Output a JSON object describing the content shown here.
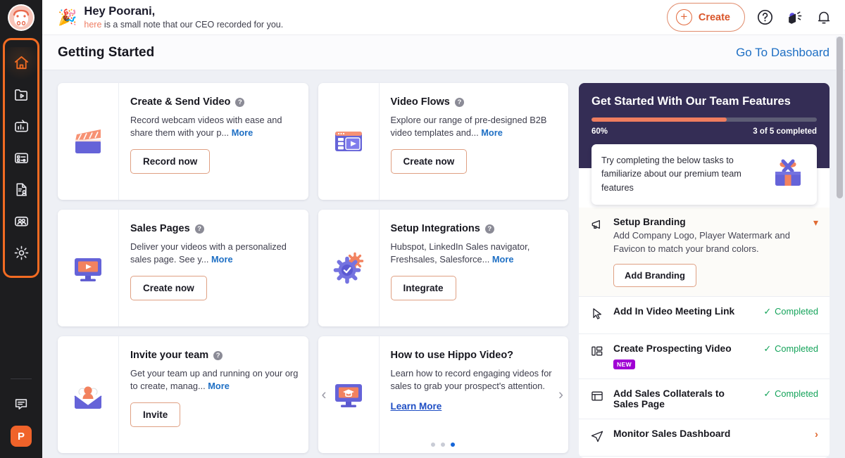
{
  "sidebar": {
    "logo_name": "hippo-logo",
    "items": [
      {
        "id": "home",
        "label": "Home",
        "icon": "home-icon",
        "active": true,
        "has_dots": true
      },
      {
        "id": "library",
        "label": "Video Library",
        "icon": "folder-video-icon",
        "active": false,
        "has_dots": false
      },
      {
        "id": "analytics",
        "label": "Analytics",
        "icon": "analytics-icon",
        "active": false,
        "has_dots": true
      },
      {
        "id": "flows",
        "label": "Flows",
        "icon": "flows-icon",
        "active": false,
        "has_dots": true
      },
      {
        "id": "prospects",
        "label": "Prospects",
        "icon": "document-person-icon",
        "active": false,
        "has_dots": false
      },
      {
        "id": "team",
        "label": "Team",
        "icon": "team-icon",
        "active": false,
        "has_dots": false
      },
      {
        "id": "settings",
        "label": "Settings",
        "icon": "gear-icon",
        "active": false,
        "has_dots": false
      }
    ],
    "chat_icon": "chat-bubble-icon",
    "avatar_initial": "P"
  },
  "topbar": {
    "party_icon": "party-popper-icon",
    "greeting": "Hey Poorani,",
    "note_link": "here",
    "note_rest": " is a small note that our CEO recorded for you.",
    "create_label": "Create",
    "help_icon": "help-circle-icon",
    "announce_icon": "megaphone-icon",
    "bell_icon": "bell-icon"
  },
  "pagehead": {
    "title": "Getting Started",
    "dashboard_link": "Go To Dashboard"
  },
  "cards": [
    {
      "icon": "clapperboard-icon",
      "title": "Create & Send Video",
      "help": "?",
      "desc": "Record webcam videos with ease and share them with your p...",
      "more": "More",
      "button": "Record now"
    },
    {
      "icon": "video-template-icon",
      "title": "Video Flows",
      "help": "?",
      "desc": "Explore our range of pre-designed B2B video templates and...",
      "more": "More",
      "button": "Create now"
    },
    {
      "icon": "monitor-play-icon",
      "title": "Sales Pages",
      "help": "?",
      "desc": "Deliver your videos with a personalized sales page. See y...",
      "more": "More",
      "button": "Create now"
    },
    {
      "icon": "gear-check-icon",
      "title": "Setup Integrations",
      "help": "?",
      "desc": "Hubspot, LinkedIn Sales navigator, Freshsales, Salesforce...",
      "more": "More",
      "button": "Integrate"
    },
    {
      "icon": "envelope-people-icon",
      "title": "Invite your team",
      "help": "?",
      "desc": "Get your team up and running on your org to create, manag...",
      "more": "More",
      "button": "Invite"
    }
  ],
  "carousel": {
    "icon": "monitor-graduation-icon",
    "title": "How to use Hippo Video?",
    "desc": "Learn how to record engaging videos for sales to grab your prospect's attention.",
    "learn_more": "Learn More",
    "prev_arrow": "chevron-left-icon",
    "next_arrow": "chevron-right-icon",
    "dots": 3,
    "active_dot": 2
  },
  "right_panel": {
    "title": "Get Started With Our Team Features",
    "progress_percent_label": "60%",
    "progress_percent": 60,
    "completed_label": "3 of 5 completed",
    "note": "Try completing the below tasks to familiarize about our premium team features",
    "gift_icon": "gift-icon",
    "tasks": [
      {
        "icon": "megaphone-icon",
        "title": "Setup Branding",
        "desc": "Add Company Logo, Player Watermark and Favicon to match your brand colors.",
        "button": "Add Branding",
        "state": "expanded",
        "status": "",
        "badge": "",
        "chevron": "chevron-down-icon"
      },
      {
        "icon": "cursor-arrow-icon",
        "title": "Add In Video Meeting Link",
        "desc": "",
        "button": "",
        "state": "done",
        "status": "Completed",
        "badge": "",
        "chevron": ""
      },
      {
        "icon": "layout-blocks-icon",
        "title": "Create Prospecting Video",
        "desc": "",
        "button": "",
        "state": "done",
        "status": "Completed",
        "badge": "NEW",
        "chevron": ""
      },
      {
        "icon": "window-icon",
        "title": "Add Sales Collaterals to Sales Page",
        "desc": "",
        "button": "",
        "state": "done",
        "status": "Completed",
        "badge": "",
        "chevron": ""
      },
      {
        "icon": "paper-plane-icon",
        "title": "Monitor Sales Dashboard",
        "desc": "",
        "button": "",
        "state": "pending",
        "status": "",
        "badge": "",
        "chevron": "chevron-right-icon"
      }
    ]
  },
  "colors": {
    "accent_orange": "#f26b22",
    "panel_dark": "#342d55",
    "progress_fill": "#ef7d5f",
    "progress_track": "#5d5d75",
    "link_blue": "#1e6fc4",
    "completed_green": "#14a35a",
    "badge_purple": "#a000d4"
  }
}
